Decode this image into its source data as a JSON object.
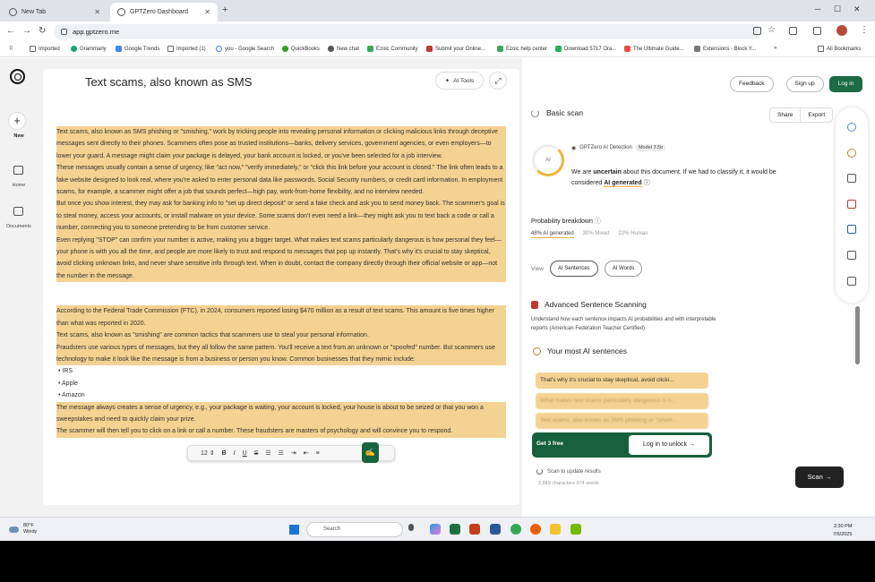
{
  "browser": {
    "tabs": [
      {
        "title": "New Tab",
        "active": false
      },
      {
        "title": "GPTZero Dashboard",
        "active": true
      }
    ],
    "url": "app.gptzero.me",
    "bookmarks": [
      "Imported",
      "Grammarly",
      "Google Trends",
      "Imported (1)",
      "you - Google Search",
      "QuickBooks",
      "New chat",
      "Ezoic Community",
      "Submit your Online...",
      "Ezoic help center",
      "Download 5717 Ora...",
      "The Ultimate Guide...",
      "Extensions - Block Y..."
    ],
    "all_bookmarks": "All Bookmarks"
  },
  "leftnav": {
    "new_label": "New",
    "home_label": "Home",
    "documents_label": "Documents"
  },
  "editor": {
    "title": "Text scams, also known as SMS",
    "ai_tools_label": "AI Tools",
    "paragraphs": [
      "Text scams, also known as SMS phishing or \"smishing,\" work by tricking people into revealing personal information or clicking malicious links through deceptive messages sent directly to their phones. Scammers often pose as trusted institutions—banks, delivery services, government agencies, or even employers—to lower your guard. A message might claim your package is delayed, your bank account is locked, or you've been selected for a job interview.",
      "These messages usually contain a sense of urgency, like \"act now,\" \"verify immediately,\" or \"click this link before your account is closed.\" The link often leads to a fake website designed to look real, where you're asked to enter personal data like passwords, Social Security numbers, or credit card information. In employment scams, for example, a scammer might offer a job that sounds perfect—high pay, work-from-home flexibility, and no interview needed.",
      "But once you show interest, they may ask for banking info to \"set up direct deposit\" or send a fake check and ask you to send money back. The scammer's goal is to steal money, access your accounts, or install malware on your device. Some scams don't even need a link—they might ask you to text back a code or call a number, connecting you to someone pretending to be from customer service.",
      "Even replying \"STOP\" can confirm your number is active, making you a bigger target. What makes text scams particularly dangerous is how personal they feel—your phone is with you all the time, and people are more likely to trust and respond to messages that pop up instantly. That's why it's crucial to stay skeptical, avoid clicking unknown links, and never share sensitive info through text. When in doubt, contact the company directly through their official website or app—not the number in the message.",
      "According to the Federal Trade Commission (FTC), in 2024, consumers reported losing $470 million as a result of text scams. This amount is five times higher than what was reported in 2020.",
      "Text scams, also known as \"smishing\" are common tactics that scammers use to steal your personal information.",
      "Fraudsters use various types of messages, but they all follow the same pattern. You'll receive a text from an unknown or \"spoofed\" number. But scammers use technology to make it look like the message is from a business or person you know. Common businesses that they mimic include:",
      "The message always creates a sense of urgency, e.g., your package is waiting, your account is locked, your house is about to be seized or that you won a sweepstakes and need to quickly claim your prize.",
      "The scammer will then tell you to click on a link or call a number. These fraudsters are masters of psychology and will convince you to respond."
    ],
    "list_items": [
      "IRS",
      "Apple",
      "Amazon"
    ],
    "format_toolbar": {
      "font_size": "12"
    }
  },
  "panel": {
    "feedback_label": "Feedback",
    "signup_label": "Sign up",
    "login_label": "Log in",
    "scan_title": "Basic scan",
    "share_label": "Share",
    "export_label": "Export",
    "ring_label": "AI",
    "detection_label": "GPTZero AI Detection",
    "model_label": "Model 3.5b",
    "verdict_pre": "We are ",
    "verdict_bold": "uncertain",
    "verdict_mid": " about this document. If we had to classify it, it would be considered ",
    "verdict_class": "AI generated",
    "prob_title": "Probability breakdown",
    "prob_ai": "48% AI generated",
    "prob_mixed": "30% Mixed",
    "prob_human": "22% Human",
    "view_label": "View",
    "ai_sentences_btn": "AI Sentences",
    "ai_words_btn": "AI Words",
    "adv_title": "Advanced Sentence Scanning",
    "adv_desc": "Understand how each sentence impacts AI probabilities and with interpretable reports (American Federation Teacher Certified)",
    "your_ai_title": "Your most AI sentences",
    "sentences": [
      "That's why it's crucial to stay skeptical, avoid clicki...",
      "What makes text scams particularly dangerous is h...",
      "Text scams, also known as SMS phishing or \"smish..."
    ],
    "get_free": "Get 3 free",
    "unlock_label": "Log in to unlock →",
    "scan_results_label": "Scan to update results",
    "chars_label": "2,849 characters 474 words",
    "scan_btn": "Scan →"
  },
  "taskbar": {
    "temp": "80°F",
    "condition": "Windy",
    "search_placeholder": "Search",
    "time": "2:30 PM",
    "date": "7/6/2025"
  }
}
